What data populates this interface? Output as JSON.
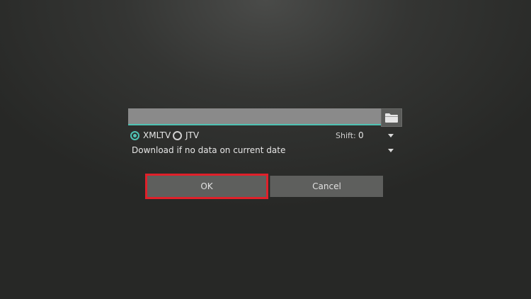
{
  "source": {
    "url_value": "",
    "url_placeholder": ""
  },
  "format": {
    "options": [
      {
        "label": "XMLTV",
        "checked": true
      },
      {
        "label": "JTV",
        "checked": false
      }
    ]
  },
  "shift": {
    "label": "Shift:",
    "value": "0"
  },
  "download": {
    "selected": "Download if no data on current date"
  },
  "buttons": {
    "ok_label": "OK",
    "cancel_label": "Cancel"
  },
  "colors": {
    "accent": "#4fc3b4",
    "highlight": "#e0202a"
  },
  "icons": {
    "browse": "folder-icon",
    "dropdown": "caret-down-icon"
  }
}
